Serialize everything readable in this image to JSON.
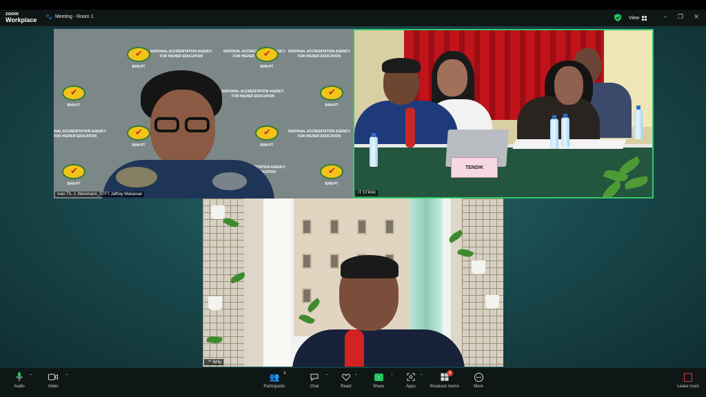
{
  "app": {
    "logo_line1": "zoom",
    "logo_line2": "Workplace"
  },
  "titlebar": {
    "meeting_title": "Meeting - Room 1",
    "view_label": "View"
  },
  "window_controls": {
    "minimize": "–",
    "restore": "❐",
    "close": "✕"
  },
  "tiles": [
    {
      "participant_name": "Ivan Th. J. Weismann_STFT Jaffray Makassar",
      "muted": false
    },
    {
      "participant_name": "IT STPAK",
      "muted": false
    },
    {
      "participant_name": "Willy",
      "muted": true
    }
  ],
  "backdrop": {
    "agency_line1": "NATIONAL ACCREDITATION AGENCY",
    "agency_line2": "FOR HIGHER EDUCATION",
    "badge_text": "BAN-PT"
  },
  "room_sign": "TENDIK",
  "toolbar": {
    "audio": "Audio",
    "video": "Video",
    "participants": "Participants",
    "participants_count": "4",
    "chat": "Chat",
    "react": "React",
    "share": "Share",
    "apps": "Apps",
    "breakout": "Breakout rooms",
    "breakout_badge": "4",
    "more": "More",
    "leave": "Leave room"
  },
  "colors": {
    "accent_green": "#37c96b",
    "toolbar_bg": "#0f1616",
    "leave_red": "#e53935"
  }
}
